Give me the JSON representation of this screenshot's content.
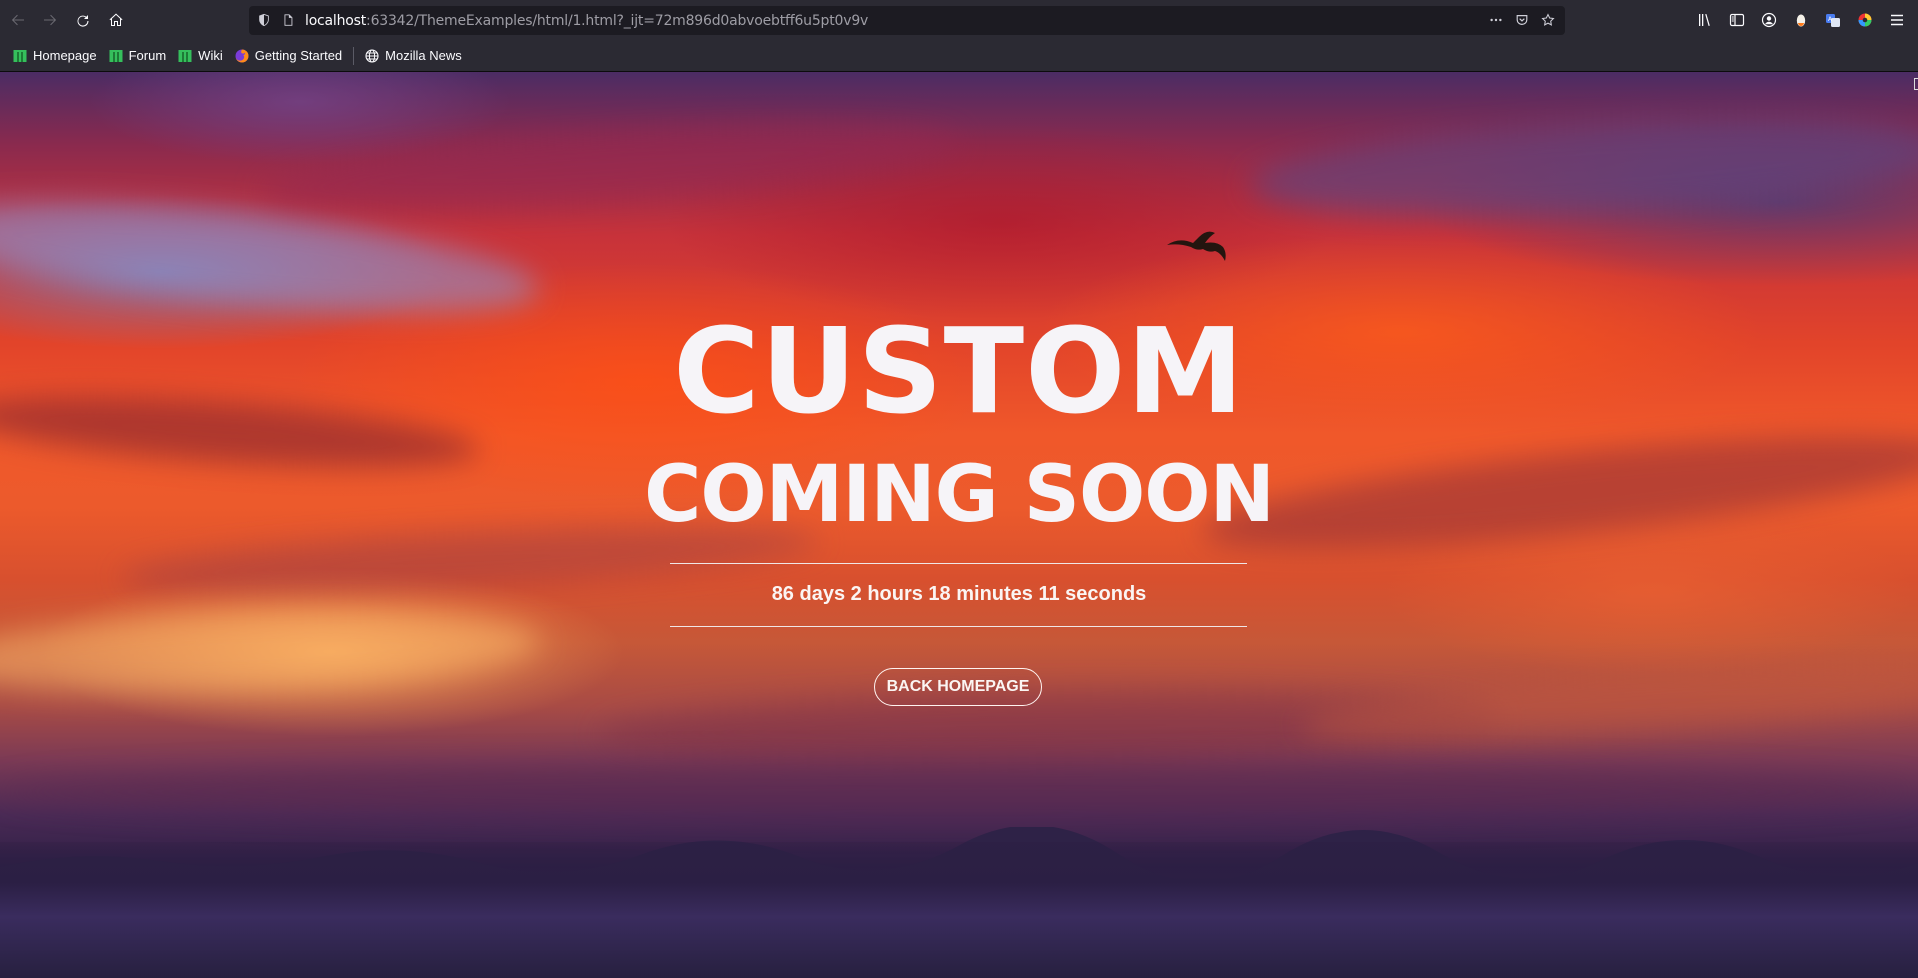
{
  "browser": {
    "url_host": "localhost",
    "url_rest": ":63342/ThemeExamples/html/1.html?_ijt=72m896d0abvoebtff6u5pt0v9v",
    "bookmarks": [
      {
        "label": "Homepage",
        "icon": "green-square-icon"
      },
      {
        "label": "Forum",
        "icon": "green-square-icon"
      },
      {
        "label": "Wiki",
        "icon": "green-square-icon"
      },
      {
        "label": "Getting Started",
        "icon": "firefox-icon"
      },
      {
        "label": "Mozilla News",
        "icon": "globe-icon"
      }
    ]
  },
  "page": {
    "title_line1": "CUSTOM",
    "title_line2": "COMING SOON",
    "countdown": "86 days 2 hours 18 minutes 11 seconds",
    "back_button": "BACK HOMEPAGE"
  },
  "colors": {
    "chrome_bg": "#2b2a33",
    "urlbar_bg": "#1c1b22",
    "bookmark_green": "#2ac84b",
    "sky_orange": "#f0582a",
    "sky_purple": "#4b2c64"
  }
}
